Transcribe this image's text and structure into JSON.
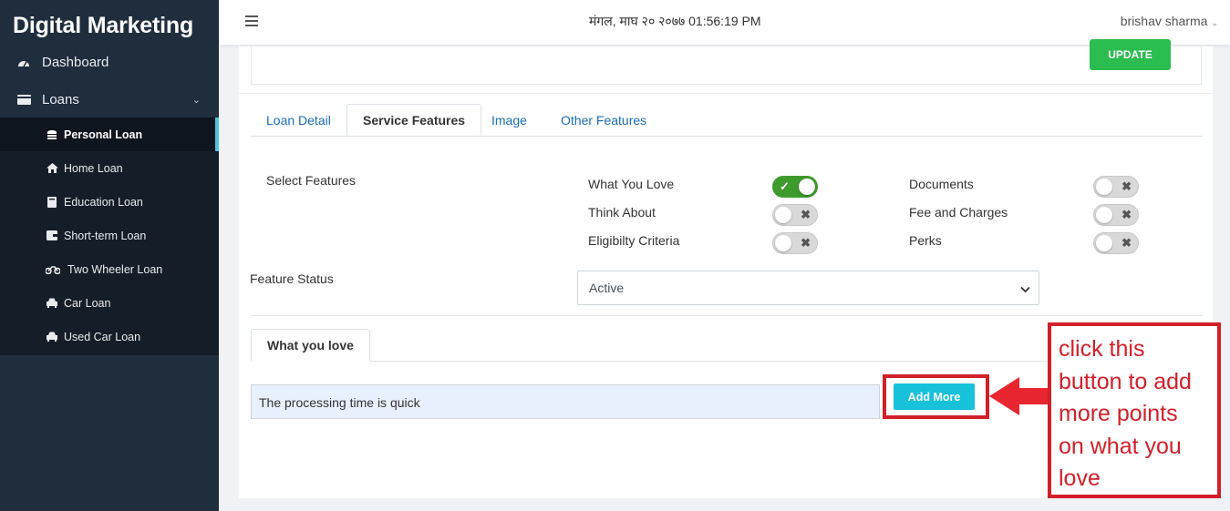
{
  "sidebar": {
    "brand": "Digital Marketing",
    "dashboard": "Dashboard",
    "loans": "Loans",
    "items": [
      {
        "label": "Personal Loan",
        "icon": "coins-icon"
      },
      {
        "label": "Home Loan",
        "icon": "home-icon"
      },
      {
        "label": "Education Loan",
        "icon": "book-icon"
      },
      {
        "label": "Short-term Loan",
        "icon": "wallet-icon"
      },
      {
        "label": "Two Wheeler Loan",
        "icon": "motorcycle-icon"
      },
      {
        "label": "Car Loan",
        "icon": "car-icon"
      },
      {
        "label": "Used Car Loan",
        "icon": "car-icon"
      }
    ],
    "active_item": "Personal Loan"
  },
  "topbar": {
    "datetime": "मंगल, माघ २० २०७७ 01:56:19 PM",
    "user": "brishav sharma"
  },
  "update_label": "UPDATE",
  "tabs": [
    "Loan Detail",
    "Service Features",
    "Image",
    "Other Features"
  ],
  "active_tab": "Service Features",
  "select_features_label": "Select Features",
  "features": [
    {
      "label": "What You Love",
      "enabled": true
    },
    {
      "label": "Think About",
      "enabled": false
    },
    {
      "label": "Eligibilty Criteria",
      "enabled": false
    },
    {
      "label": "Documents",
      "enabled": false
    },
    {
      "label": "Fee and Charges",
      "enabled": false
    },
    {
      "label": "Perks",
      "enabled": false
    }
  ],
  "feature_status": {
    "label": "Feature Status",
    "value": "Active"
  },
  "section_tab": "What you love",
  "point_value": "The processing time is quick",
  "add_more_label": "Add More",
  "annotation_lines": [
    "click this",
    "button to add",
    "more points",
    "on what you",
    "love"
  ],
  "colors": {
    "sidebar": "#1f2d3d",
    "toggle_on": "#3d9a2d",
    "update": "#2bbd4f",
    "add_more": "#17c1da",
    "annotation": "#d0202a",
    "link": "#1a6cb8"
  }
}
